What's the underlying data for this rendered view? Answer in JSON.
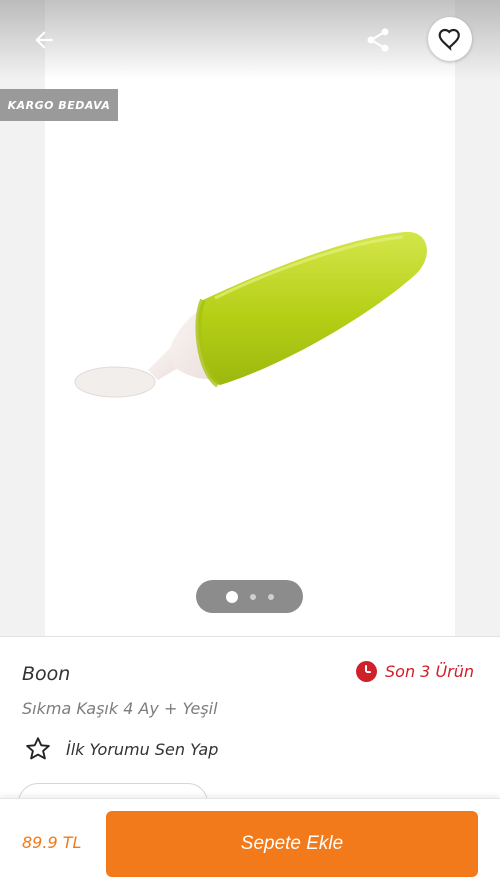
{
  "gallery": {
    "badge": "KARGO BEDAVA",
    "slide_count": 3,
    "active_slide": 1
  },
  "product": {
    "brand": "Boon",
    "name": "Sıkma Kaşık 4 Ay + Yeşil",
    "stock_note": "Son 3 Ürün",
    "review_prompt": "İlk Yorumu Sen Yap",
    "image_colors": {
      "body": "#b9d21a",
      "spoon": "#f4ecea"
    }
  },
  "cart": {
    "price": "89.9 TL",
    "add_label": "Sepete Ekle"
  },
  "colors": {
    "accent": "#f27a1a",
    "stock_red": "#d0202a",
    "badge_gray": "#9a9a9a"
  },
  "icons": [
    "arrow-left-icon",
    "share-icon",
    "heart-icon",
    "clock-icon",
    "star-icon"
  ]
}
